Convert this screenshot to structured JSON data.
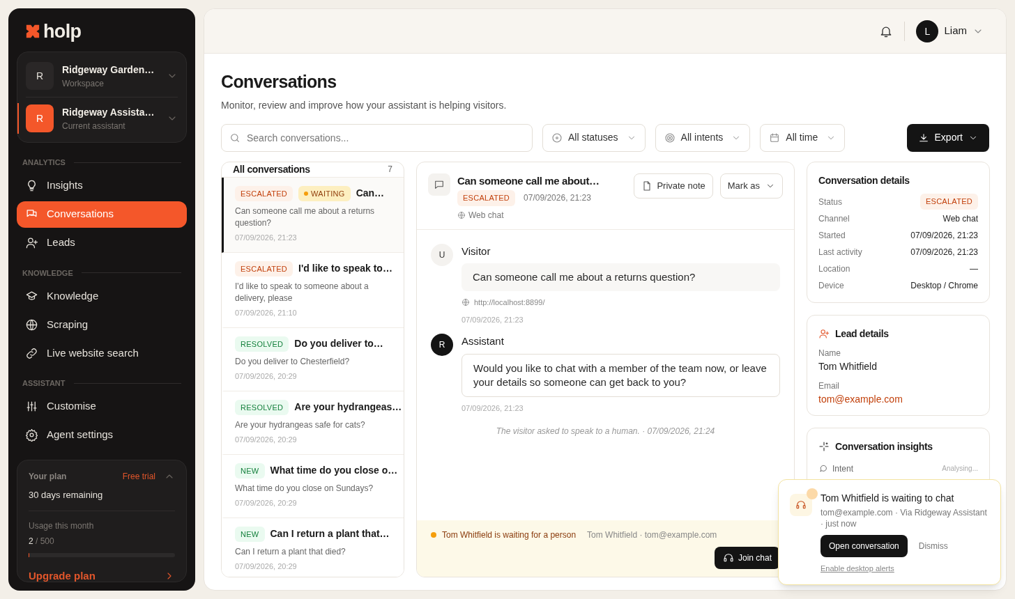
{
  "brand": {
    "name": "holp"
  },
  "switcher": [
    {
      "initial": "R",
      "name": "Ridgeway Garden…",
      "subtitle": "Workspace",
      "selected": false
    },
    {
      "initial": "R",
      "name": "Ridgeway Assista…",
      "subtitle": "Current assistant",
      "selected": true
    }
  ],
  "sidebar": {
    "sections": [
      {
        "heading": "ANALYTICS",
        "items": [
          {
            "label": "Insights",
            "selected": false
          },
          {
            "label": "Conversations",
            "selected": true
          },
          {
            "label": "Leads",
            "selected": false
          }
        ]
      },
      {
        "heading": "KNOWLEDGE",
        "items": [
          {
            "label": "Knowledge",
            "selected": false
          },
          {
            "label": "Scraping",
            "selected": false
          },
          {
            "label": "Live website search",
            "selected": false
          }
        ]
      },
      {
        "heading": "ASSISTANT",
        "items": [
          {
            "label": "Customise",
            "selected": false
          },
          {
            "label": "Agent settings",
            "selected": false
          }
        ]
      }
    ]
  },
  "plan": {
    "title": "Your plan",
    "badge": "Free trial",
    "remaining": "30 days remaining",
    "usage_label": "Usage this month",
    "usage_used": "2",
    "usage_total": "/ 500",
    "level": 0.004,
    "upgrade": "Upgrade plan"
  },
  "header": {
    "user": {
      "initial": "L",
      "name": "Liam"
    }
  },
  "page": {
    "title": "Conversations",
    "subtitle": "Monitor, review and improve how your assistant is helping visitors."
  },
  "filters": {
    "search_placeholder": "Search conversations...",
    "dropdowns": [
      "All statuses",
      "All intents",
      "All time"
    ],
    "export": "Export"
  },
  "list": {
    "title": "All conversations",
    "count": "7",
    "items": [
      {
        "badges": [
          {
            "kind": "escalated",
            "label": "ESCALATED"
          },
          {
            "kind": "waiting",
            "label": "WAITING"
          }
        ],
        "title": "Can…",
        "preview": "Can someone call me about a returns question?",
        "time": "07/09/2026, 21:23",
        "selected": true
      },
      {
        "badges": [
          {
            "kind": "escalated",
            "label": "ESCALATED"
          }
        ],
        "title": "I'd like to speak to…",
        "preview": "I'd like to speak to someone about a delivery, please",
        "time": "07/09/2026, 21:10",
        "selected": false
      },
      {
        "badges": [
          {
            "kind": "resolved",
            "label": "RESOLVED"
          }
        ],
        "title": "Do you deliver to…",
        "preview": "Do you deliver to Chesterfield?",
        "time": "07/09/2026, 20:29",
        "selected": false
      },
      {
        "badges": [
          {
            "kind": "resolved",
            "label": "RESOLVED"
          }
        ],
        "title": "Are your hydrangeas…",
        "preview": "Are your hydrangeas safe for cats?",
        "time": "07/09/2026, 20:29",
        "selected": false
      },
      {
        "badges": [
          {
            "kind": "new",
            "label": "NEW"
          }
        ],
        "title": "What time do you close o…",
        "preview": "What time do you close on Sundays?",
        "time": "07/09/2026, 20:29",
        "selected": false
      },
      {
        "badges": [
          {
            "kind": "new",
            "label": "NEW"
          }
        ],
        "title": "Can I return a plant that…",
        "preview": "Can I return a plant that died?",
        "time": "07/09/2026, 20:29",
        "selected": false
      }
    ]
  },
  "conversation": {
    "title": "Can someone call me about…",
    "badge": {
      "kind": "escalated",
      "label": "ESCALATED"
    },
    "time": "07/09/2026, 21:23",
    "channel": "Web chat",
    "note_button": "Private note",
    "mark_button": "Mark as",
    "messages": [
      {
        "kind": "visitor",
        "avatar": "U",
        "sender": "Visitor",
        "text": "Can someone call me about a returns question?",
        "url": "http://localhost:8899/",
        "time": "07/09/2026, 21:23"
      },
      {
        "kind": "assistant",
        "avatar": "R",
        "sender": "Assistant",
        "text": "Would you like to chat with a member of the team now, or leave your details so someone can get back to you?",
        "time": "07/09/2026, 21:23"
      }
    ],
    "system_note": "The visitor asked to speak to a human. · 07/09/2026, 21:24",
    "banner": {
      "text": "Tom Whitfield is waiting for a person",
      "contact": "Tom Whitfield · tom@example.com",
      "button": "Join chat"
    }
  },
  "details": {
    "title": "Conversation details",
    "rows": [
      {
        "label": "Status",
        "value": "ESCALATED",
        "kind": "badge"
      },
      {
        "label": "Channel",
        "value": "Web chat",
        "kind": "text"
      },
      {
        "label": "Started",
        "value": "07/09/2026, 21:23",
        "kind": "text"
      },
      {
        "label": "Last activity",
        "value": "07/09/2026, 21:23",
        "kind": "text"
      },
      {
        "label": "Location",
        "value": "—",
        "kind": "text"
      },
      {
        "label": "Device",
        "value": "Desktop / Chrome",
        "kind": "text"
      }
    ]
  },
  "lead": {
    "title": "Lead details",
    "fields": [
      {
        "label": "Name",
        "value": "Tom Whitfield",
        "kind": "text"
      },
      {
        "label": "Email",
        "value": "tom@example.com",
        "kind": "link"
      }
    ]
  },
  "insights": {
    "title": "Conversation insights",
    "rows": [
      {
        "label": "Intent",
        "value": "Analysing..."
      }
    ]
  },
  "toast": {
    "title": "Tom Whitfield is waiting to chat",
    "body": "tom@example.com · Via Ridgeway Assistant · just now",
    "primary": "Open conversation",
    "secondary": "Dismiss",
    "link": "Enable desktop alerts"
  }
}
